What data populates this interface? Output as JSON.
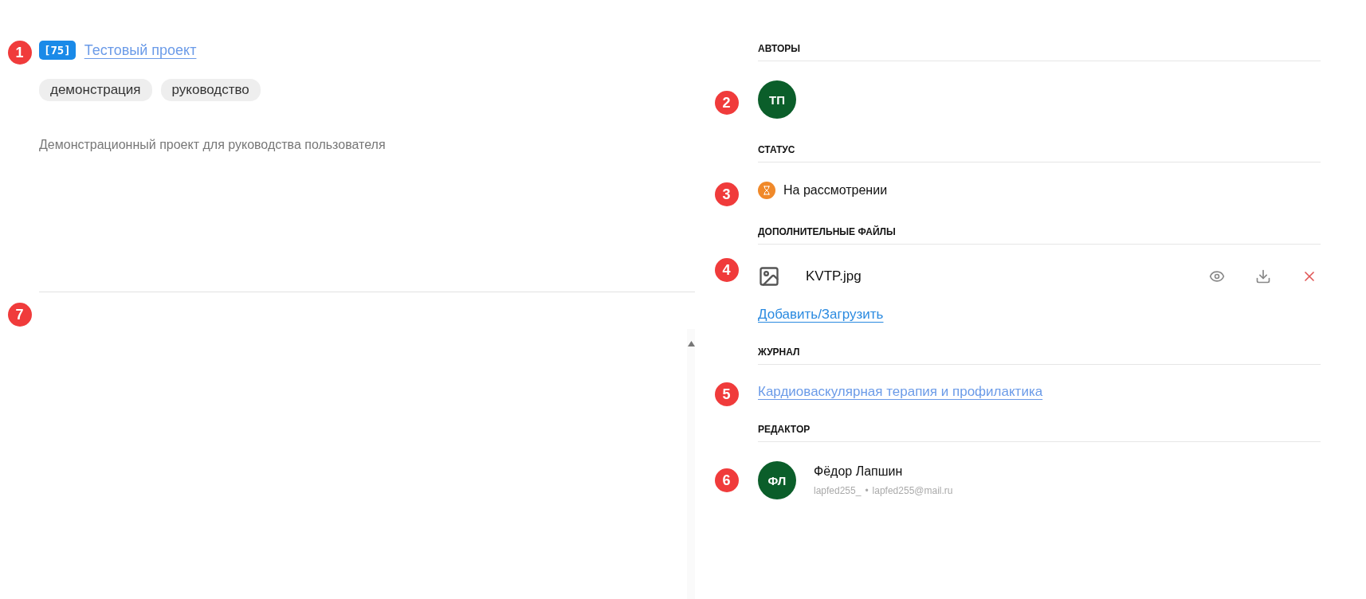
{
  "project": {
    "marker": "1",
    "id_badge": "[75]",
    "title": "Тестовый проект",
    "tags": [
      "демонстрация",
      "руководство"
    ],
    "description": "Демонстрационный проект для руководства пользователя"
  },
  "lower_panel": {
    "marker": "7"
  },
  "authors": {
    "heading": "АВТОРЫ",
    "marker": "2",
    "people": [
      {
        "initials": "ТП",
        "color": "#0b5e2a"
      }
    ]
  },
  "status": {
    "heading": "СТАТУС",
    "marker": "3",
    "label": "На рассмотрении",
    "color": "#f0892a"
  },
  "files": {
    "heading": "ДОПОЛНИТЕЛЬНЫЕ ФАЙЛЫ",
    "marker": "4",
    "items": [
      {
        "name": "KVTP.jpg"
      }
    ],
    "add_link": "Добавить/Загрузить"
  },
  "journal": {
    "heading": "ЖУРНАЛ",
    "marker": "5",
    "link": "Кардиоваскулярная терапия и профилактика"
  },
  "editor": {
    "heading": "РЕДАКТОР",
    "marker": "6",
    "initials": "ФЛ",
    "color": "#0b5e2a",
    "name": "Фёдор Лапшин",
    "username": "lapfed255_",
    "separator": "•",
    "email": "lapfed255@mail.ru"
  }
}
